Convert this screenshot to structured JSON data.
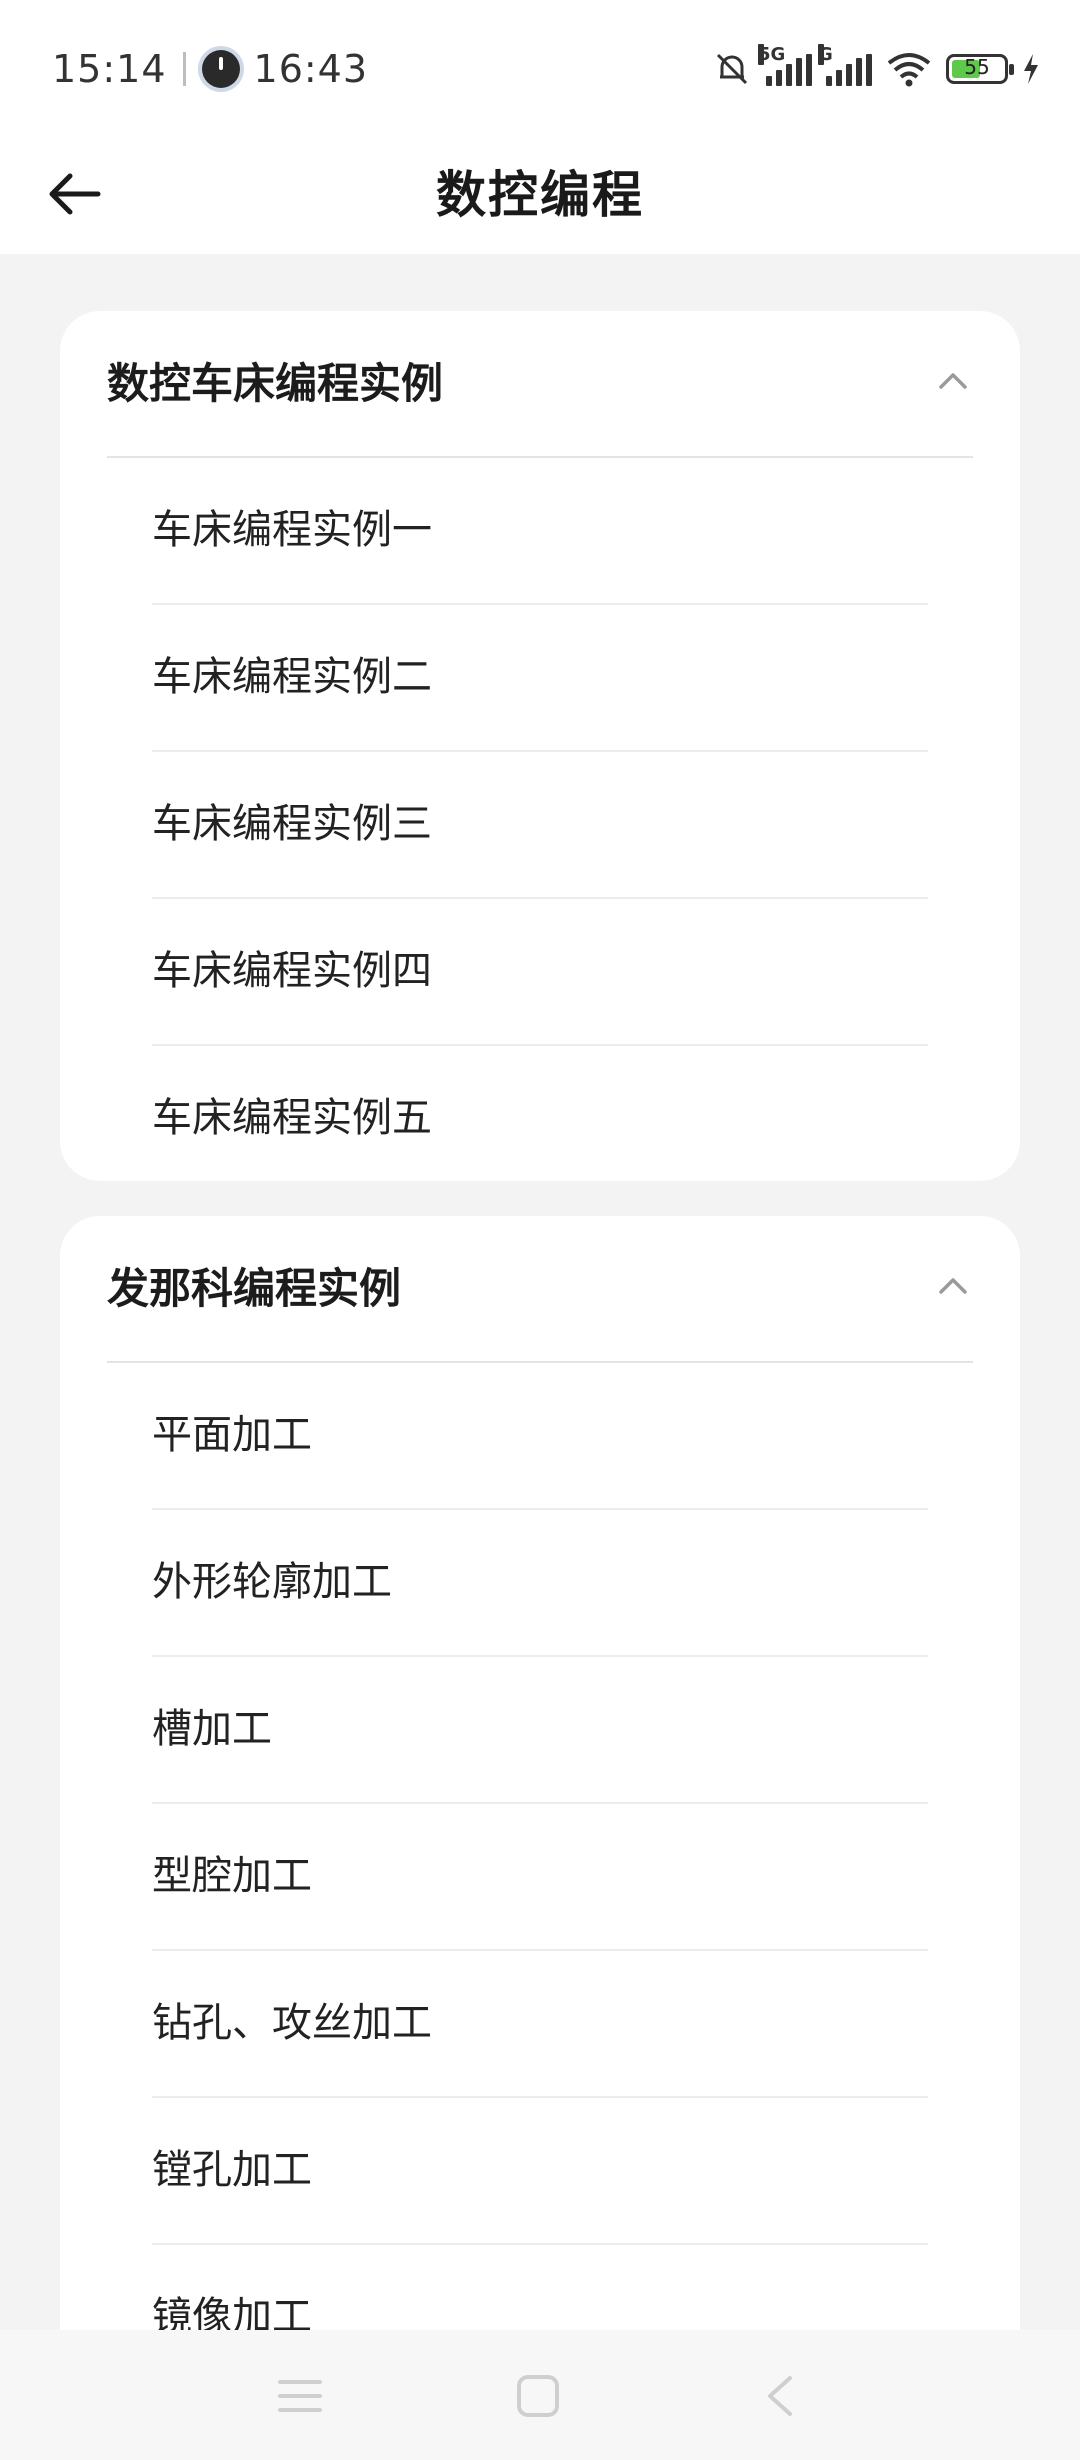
{
  "status_bar": {
    "time": "15:14",
    "clock_time": "16:43",
    "battery_level": "55",
    "signal_1_label": "5G",
    "signal_2_label": "G"
  },
  "header": {
    "title": "数控编程"
  },
  "sections": [
    {
      "title": "数控车床编程实例",
      "items": [
        "车床编程实例一",
        "车床编程实例二",
        "车床编程实例三",
        "车床编程实例四",
        "车床编程实例五"
      ]
    },
    {
      "title": "发那科编程实例",
      "items": [
        "平面加工",
        "外形轮廓加工",
        "槽加工",
        "型腔加工",
        "钻孔、攻丝加工",
        "镗孔加工",
        "镜像加工"
      ]
    }
  ],
  "colors": {
    "background": "#f3f3f3",
    "card": "#ffffff",
    "battery_fill": "#5ec94a"
  }
}
